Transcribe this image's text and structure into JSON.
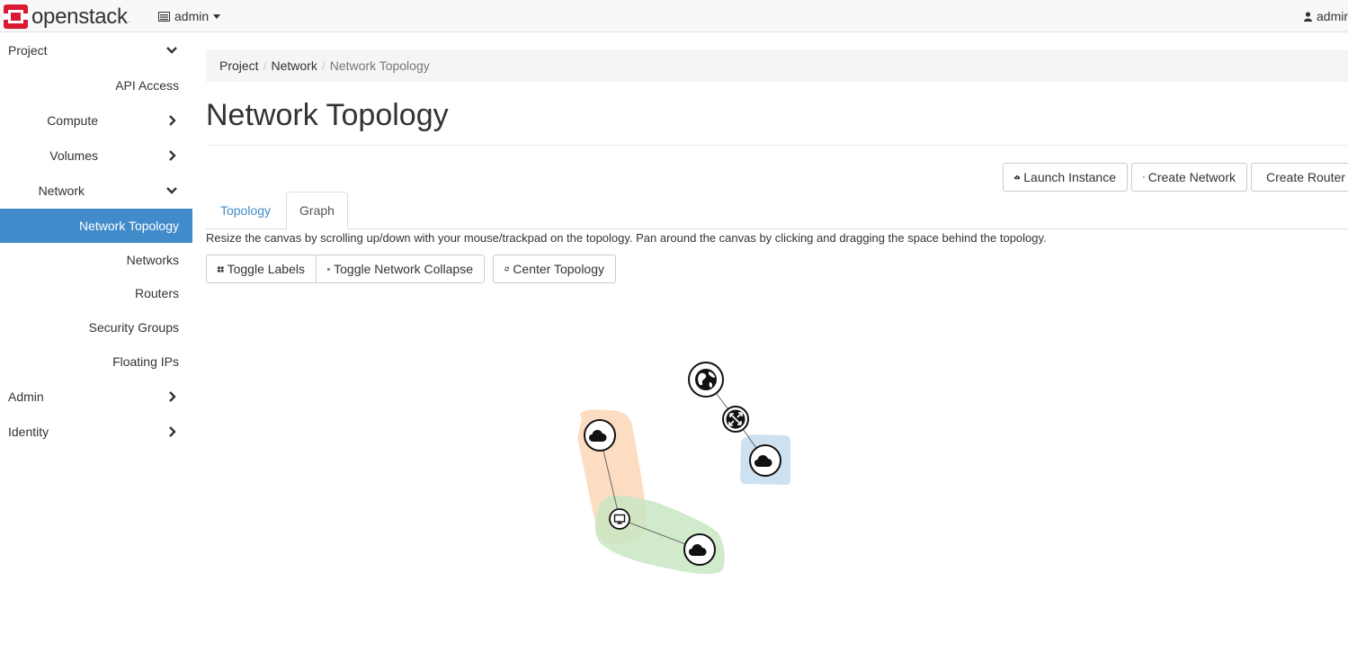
{
  "brand": {
    "name": "openstack",
    "trademark": "."
  },
  "navbar": {
    "project_selector": "admin",
    "user_menu": "admin"
  },
  "sidebar": {
    "items": [
      {
        "label": "Project",
        "chevron": "chevron-down-icon"
      },
      {
        "label": "API Access"
      },
      {
        "label": "Compute",
        "chevron": "chevron-right-icon"
      },
      {
        "label": "Volumes",
        "chevron": "chevron-right-icon"
      },
      {
        "label": "Network",
        "chevron": "chevron-down-icon"
      },
      {
        "label": "Network Topology",
        "active": true
      },
      {
        "label": "Networks"
      },
      {
        "label": "Routers"
      },
      {
        "label": "Security Groups"
      },
      {
        "label": "Floating IPs"
      },
      {
        "label": "Admin",
        "chevron": "chevron-right-icon"
      },
      {
        "label": "Identity",
        "chevron": "chevron-right-icon"
      }
    ]
  },
  "breadcrumb": {
    "items": [
      "Project",
      "Network"
    ],
    "current": "Network Topology"
  },
  "page": {
    "title": "Network Topology"
  },
  "actions": {
    "launch_instance": "Launch Instance",
    "create_network": "Create Network",
    "create_router": "Create Router"
  },
  "tabs": [
    {
      "label": "Topology",
      "active": false
    },
    {
      "label": "Graph",
      "active": true
    }
  ],
  "help_text": "Resize the canvas by scrolling up/down with your mouse/trackpad on the topology. Pan around the canvas by clicking and dragging the space behind the topology.",
  "toolbar": {
    "toggle_labels": "Toggle Labels",
    "toggle_collapse": "Toggle Network Collapse",
    "center_topology": "Center Topology"
  },
  "topology": {
    "nodes": [
      {
        "id": "external",
        "type": "external-network",
        "icon": "globe-icon"
      },
      {
        "id": "router",
        "type": "router",
        "icon": "router-icon"
      },
      {
        "id": "net-blue",
        "type": "network",
        "icon": "cloud-icon",
        "group_color": "#c6dcef"
      },
      {
        "id": "net-orange",
        "type": "network",
        "icon": "cloud-icon",
        "group_color": "#fbd7b6"
      },
      {
        "id": "net-green",
        "type": "network",
        "icon": "cloud-icon",
        "group_color": "#c9e6c3"
      },
      {
        "id": "instance",
        "type": "instance",
        "icon": "monitor-icon"
      }
    ],
    "links": [
      [
        "external",
        "router"
      ],
      [
        "router",
        "net-blue"
      ],
      [
        "net-orange",
        "instance"
      ],
      [
        "instance",
        "net-green"
      ]
    ]
  },
  "colors": {
    "accent": "#428bca",
    "brand_red": "#da1a32"
  }
}
